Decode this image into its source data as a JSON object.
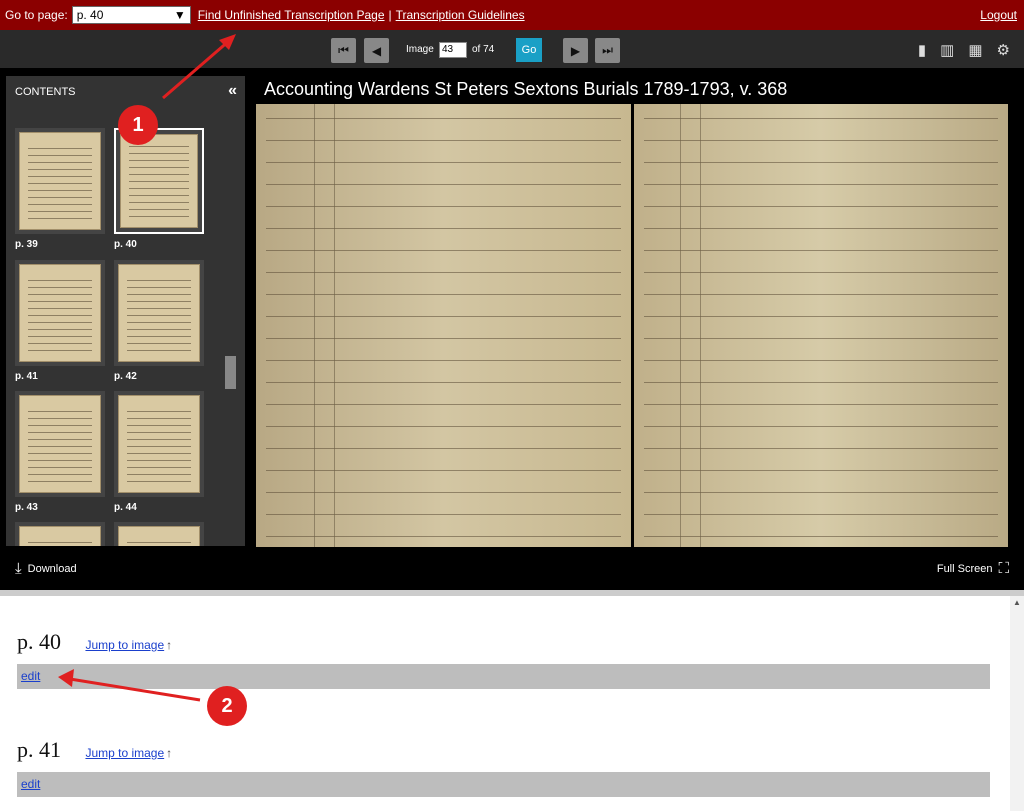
{
  "topbar": {
    "goto_label": "Go to page:",
    "page_select_value": "p. 40",
    "find_unfinished_label": "Find Unfinished Transcription Page",
    "separator": "|",
    "guidelines_label": "Transcription Guidelines",
    "logout_label": "Logout"
  },
  "toolbar": {
    "image_label": "Image",
    "image_value": "43",
    "of_label": "of 74",
    "go_label": "Go"
  },
  "sidebar": {
    "header": "CONTENTS",
    "thumbs": [
      "p. 39",
      "p. 40",
      "p. 41",
      "p. 42",
      "p. 43",
      "p. 44"
    ]
  },
  "document": {
    "title": "Accounting Wardens St Peters Sextons Burials 1789-1793, v. 368"
  },
  "bottombar": {
    "download_label": "Download",
    "fullscreen_label": "Full Screen"
  },
  "entries": [
    {
      "title": "p. 40",
      "jump_label": "Jump to image",
      "edit_label": "edit"
    },
    {
      "title": "p. 41",
      "jump_label": "Jump to image",
      "edit_label": "edit"
    }
  ],
  "annotations": [
    "1",
    "2"
  ],
  "colors": {
    "topbar": "#8b0000",
    "go_button": "#1aa0c6",
    "annotation": "#e02020"
  }
}
